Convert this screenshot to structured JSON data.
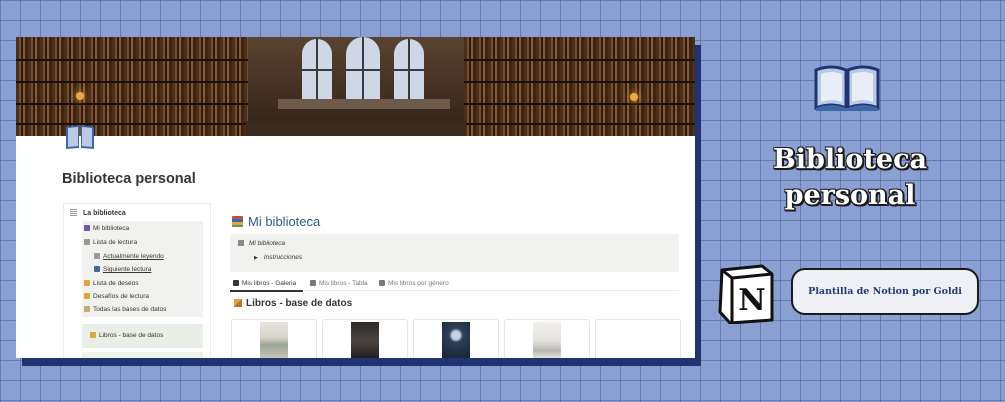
{
  "notion_window": {
    "page_title": "Biblioteca personal",
    "sidebar": {
      "header": "La biblioteca",
      "items": [
        {
          "label": "Mi biblioteca",
          "icon": "books-icon",
          "color": "#6b5aa8"
        },
        {
          "label": "Lista de lectura",
          "icon": "checklist-icon",
          "color": "#9b9a97"
        },
        {
          "label": "Actualmente leyendo",
          "icon": "open-book-icon",
          "color": "#9b9a97"
        },
        {
          "label": "Siguiente lectura",
          "icon": "next-icon",
          "color": "#3f66a8"
        },
        {
          "label": "Lista de deseos",
          "icon": "star-icon",
          "color": "#e3a33b"
        },
        {
          "label": "Desafíos de lectura",
          "icon": "trophy-icon",
          "color": "#e3a33b"
        },
        {
          "label": "Todas las bases de datos",
          "icon": "archive-icon",
          "color": "#c9a86b"
        }
      ],
      "database_link": "Libros - base de datos"
    },
    "main": {
      "title": "Mi biblioteca",
      "callout_line1": "Mi biblioteca",
      "callout_toggle": "Instrucciones",
      "tabs": [
        {
          "label": "Mis libros - Galeria",
          "active": true
        },
        {
          "label": "Mis libros - Tabla",
          "active": false
        },
        {
          "label": "Mis libros por género",
          "active": false
        }
      ],
      "section_title": "Libros - base de datos",
      "cards": [
        {
          "cover": "light-cover"
        },
        {
          "cover": "dark-cover"
        },
        {
          "cover": "night-cover"
        },
        {
          "cover": "sketch-cover"
        },
        {
          "cover": "empty"
        }
      ]
    }
  },
  "brand": {
    "title_line1": "Biblioteca",
    "title_line2": "personal",
    "notion_letter": "N",
    "tagline": "Plantilla de Notion por Goldi",
    "accent_color": "#1e3a7a",
    "background_color": "#8a9fd2"
  }
}
